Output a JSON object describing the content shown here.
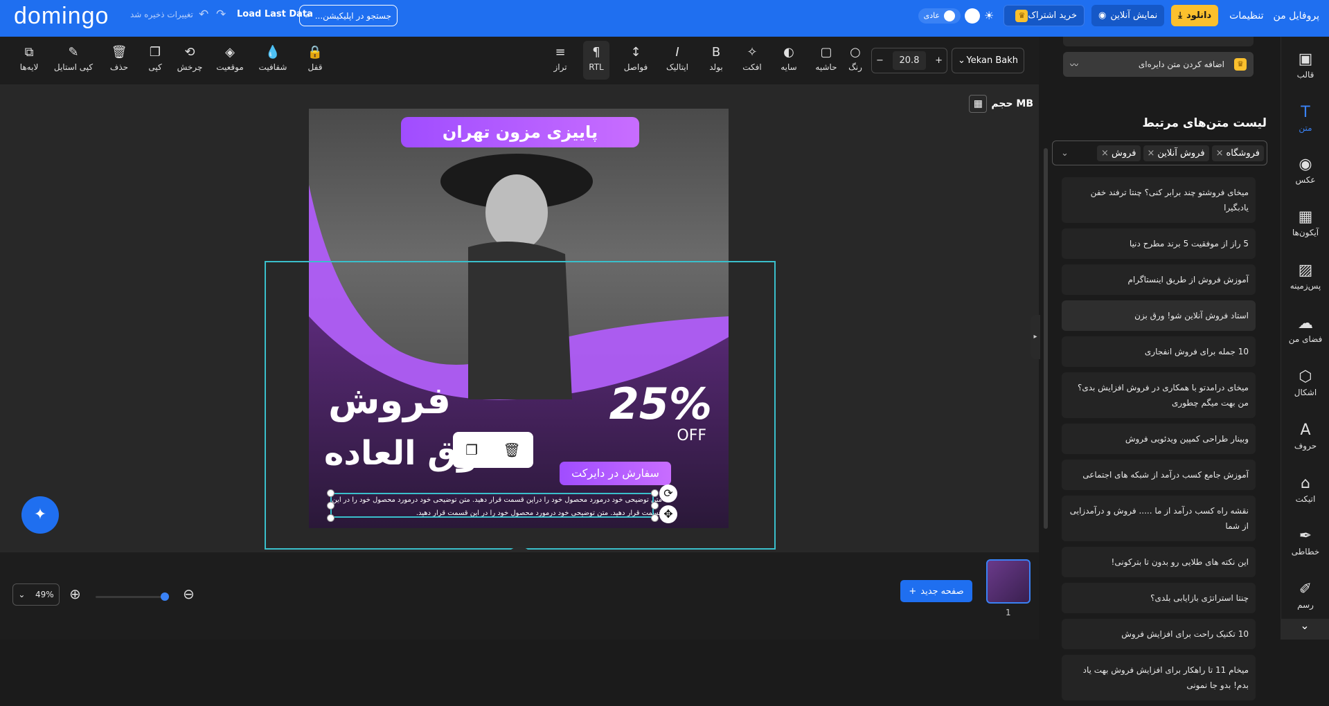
{
  "header": {
    "logo": "domingo",
    "saved_status": "تغییرات ذخیره شد",
    "undo_icon": "↶",
    "redo_icon": "↷",
    "load_last": "Load Last Data",
    "search_placeholder": "جستجو در اپلیکیشن...",
    "menu": {
      "profile": "پروفایل من",
      "settings": "تنظیمات"
    },
    "download": "دانلود",
    "online_view": "نمایش آنلاین",
    "buy_subscription": "خرید اشتراک",
    "mode_label": "عادی"
  },
  "toolbar": {
    "font_name": "Yekan Bakh",
    "font_size": "20.8",
    "minus": "−",
    "plus": "+",
    "items": [
      {
        "label": "لایه‌ها",
        "icon": "⧉"
      },
      {
        "label": "کپی استایل",
        "icon": "✎"
      },
      {
        "label": "حذف",
        "icon": "🗑"
      },
      {
        "label": "کپی",
        "icon": "❐"
      },
      {
        "label": "چرخش",
        "icon": "⟲"
      },
      {
        "label": "موقعیت",
        "icon": "◈"
      },
      {
        "label": "شفافیت",
        "icon": "💧"
      },
      {
        "label": "قفل",
        "icon": "🔒"
      },
      {
        "label": "تراز",
        "icon": "≡"
      },
      {
        "label": "RTL",
        "icon": "¶"
      },
      {
        "label": "فواصل",
        "icon": "↕"
      },
      {
        "label": "ایتالیک",
        "icon": "I"
      },
      {
        "label": "بولد",
        "icon": "B"
      },
      {
        "label": "افکت",
        "icon": "✧"
      },
      {
        "label": "سایه",
        "icon": "◐"
      },
      {
        "label": "حاشیه",
        "icon": "▢"
      },
      {
        "label": "رنگ",
        "icon": "○"
      }
    ]
  },
  "workspace": {
    "size_label": "حجم MB"
  },
  "design": {
    "title": "پاییزی مزون تهران",
    "big_line1": "فروش",
    "big_line2": "فوق العاده",
    "percent": "25%",
    "off": "OFF",
    "order_button": "سفارش در دایرکت",
    "description": "متن توضیحی خود درمورد محصول خود را دراین قسمت قرار دهید. متن توضیحی خود درمورد محصول خود را در این قسمت قرار دهید. متن توضیحی خود درمورد محصول خود را در این قسمت قرار دهید."
  },
  "bottom": {
    "zoom": "49%",
    "new_page": "صفحه جدید",
    "page_number": "1"
  },
  "panel": {
    "circle_text": "اضافه کردن متن دایره‌ای",
    "related_title": "لیست متن‌های مرتبط",
    "tags": [
      "فروشگاه",
      "فروش آنلاین",
      "فروش"
    ],
    "texts": [
      "میخای فروشتو چند برابر کنی؟ چنتا ترفند خفن یادبگیرا",
      "5 راز از موفقیت 5 برند مطرح دنیا",
      "آموزش فروش از طریق اینستاگرام",
      "استاد فروش آنلاین شو! ورق بزن",
      "10 جمله برای فروش انفجاری",
      "میخای درامدتو با همکاری در فروش افزایش بدی؟ من بهت میگم چطوری",
      "وبینار طراحی کمپین ویدئویی فروش",
      "آموزش جامع کسب درآمد از شبکه های اجتماعی",
      "نقشه راه کسب درآمد از ما ..... فروش و درآمدزایی از شما",
      "این نکته های طلایی رو بدون تا بترکونی!",
      "چنتا استراتژی بازایابی بلدی؟",
      "10 تکنیک راحت برای افزایش فروش",
      "میخام 11 تا راهکار برای افزایش فروش بهت یاد بدم! بدو جا نمونی"
    ]
  },
  "nav": [
    {
      "label": "قالب",
      "icon": "▣"
    },
    {
      "label": "متن",
      "icon": "T"
    },
    {
      "label": "عکس",
      "icon": "◉"
    },
    {
      "label": "آیکون‌ها",
      "icon": "▦"
    },
    {
      "label": "پس‌زمینه",
      "icon": "▨"
    },
    {
      "label": "فضای من",
      "icon": "☁"
    },
    {
      "label": "اشکال",
      "icon": "⬡"
    },
    {
      "label": "حروف",
      "icon": "A"
    },
    {
      "label": "اتیکت",
      "icon": "⌂"
    },
    {
      "label": "خطاطی",
      "icon": "✒"
    },
    {
      "label": "رسم",
      "icon": "✐"
    }
  ],
  "colors": {
    "brand": "#1f6ff0",
    "accent_purple": "#b45cff",
    "selection": "#3ac0cc",
    "download": "#fbc02d"
  }
}
